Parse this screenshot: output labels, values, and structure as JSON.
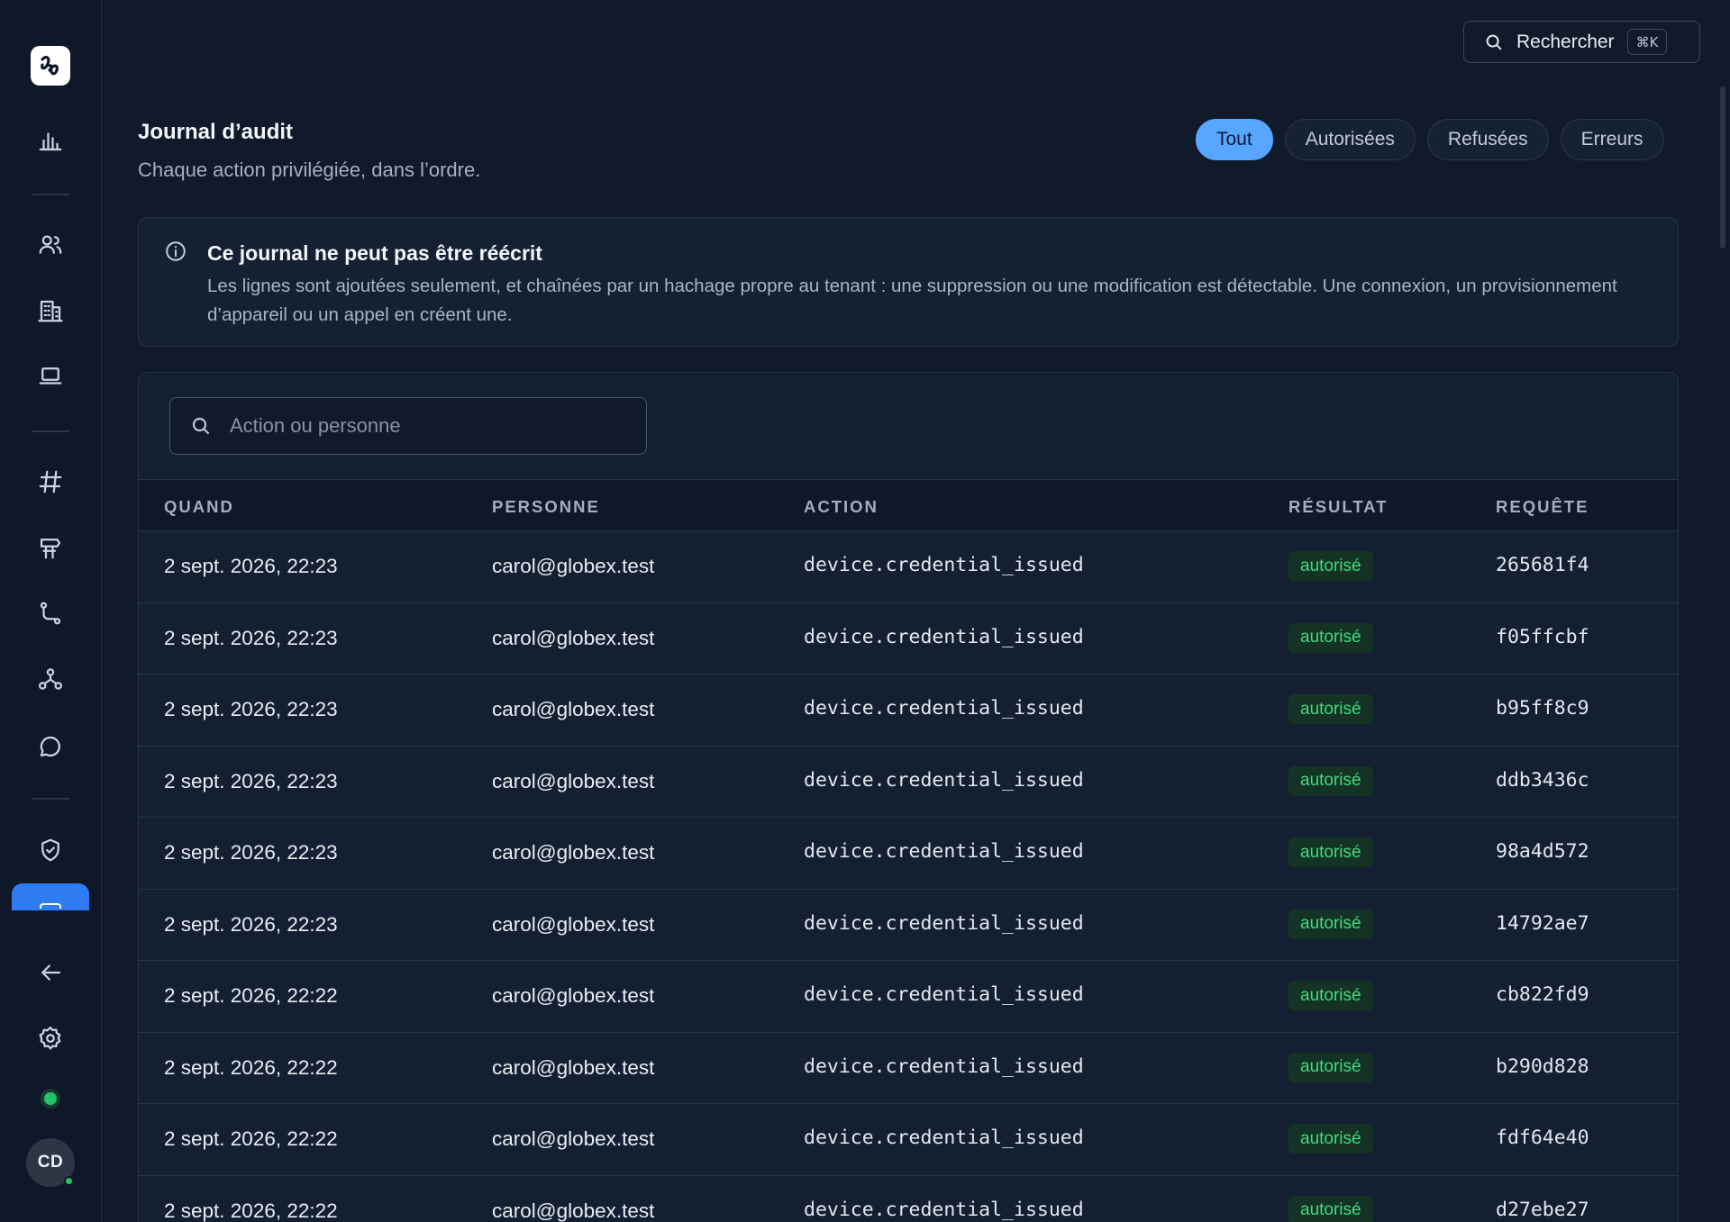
{
  "top_search": {
    "label": "Rechercher",
    "shortcut": "⌘K"
  },
  "header": {
    "title": "Journal d’audit",
    "subtitle": "Chaque action privilégiée, dans l’ordre."
  },
  "filters": [
    "Tout",
    "Autorisées",
    "Refusées",
    "Erreurs"
  ],
  "active_filter": "Tout",
  "info": {
    "title": "Ce journal ne peut pas être réécrit",
    "text": "Les lignes sont ajoutées seulement, et chaînées par un hachage propre au tenant : une suppression ou une modification est détectable. Une connexion, un provisionnement d’appareil ou un appel en créent une."
  },
  "table": {
    "search_placeholder": "Action ou personne",
    "columns": [
      "QUAND",
      "PERSONNE",
      "ACTION",
      "RÉSULTAT",
      "REQUÊTE"
    ],
    "rows": [
      {
        "when": "2 sept. 2026, 22:23",
        "person": "carol@globex.test",
        "action": "device.credential_issued",
        "result": "autorisé",
        "request": "265681f4"
      },
      {
        "when": "2 sept. 2026, 22:23",
        "person": "carol@globex.test",
        "action": "device.credential_issued",
        "result": "autorisé",
        "request": "f05ffcbf"
      },
      {
        "when": "2 sept. 2026, 22:23",
        "person": "carol@globex.test",
        "action": "device.credential_issued",
        "result": "autorisé",
        "request": "b95ff8c9"
      },
      {
        "when": "2 sept. 2026, 22:23",
        "person": "carol@globex.test",
        "action": "device.credential_issued",
        "result": "autorisé",
        "request": "ddb3436c"
      },
      {
        "when": "2 sept. 2026, 22:23",
        "person": "carol@globex.test",
        "action": "device.credential_issued",
        "result": "autorisé",
        "request": "98a4d572"
      },
      {
        "when": "2 sept. 2026, 22:23",
        "person": "carol@globex.test",
        "action": "device.credential_issued",
        "result": "autorisé",
        "request": "14792ae7"
      },
      {
        "when": "2 sept. 2026, 22:22",
        "person": "carol@globex.test",
        "action": "device.credential_issued",
        "result": "autorisé",
        "request": "cb822fd9"
      },
      {
        "when": "2 sept. 2026, 22:22",
        "person": "carol@globex.test",
        "action": "device.credential_issued",
        "result": "autorisé",
        "request": "b290d828"
      },
      {
        "when": "2 sept. 2026, 22:22",
        "person": "carol@globex.test",
        "action": "device.credential_issued",
        "result": "autorisé",
        "request": "fdf64e40"
      },
      {
        "when": "2 sept. 2026, 22:22",
        "person": "carol@globex.test",
        "action": "device.credential_issued",
        "result": "autorisé",
        "request": "d27ebe27"
      }
    ]
  },
  "user": {
    "initials": "CD"
  },
  "colors": {
    "accent": "#58a6ff",
    "success": "#3ddc7e",
    "background": "#111a2b"
  },
  "sidebar_icons": [
    "bar-chart-icon",
    "users-icon",
    "building-icon",
    "laptop-icon",
    "hash-icon",
    "signpost-icon",
    "route-icon",
    "network-icon",
    "chat-icon",
    "shield-check-icon",
    "back-arrow-icon",
    "gear-icon"
  ]
}
